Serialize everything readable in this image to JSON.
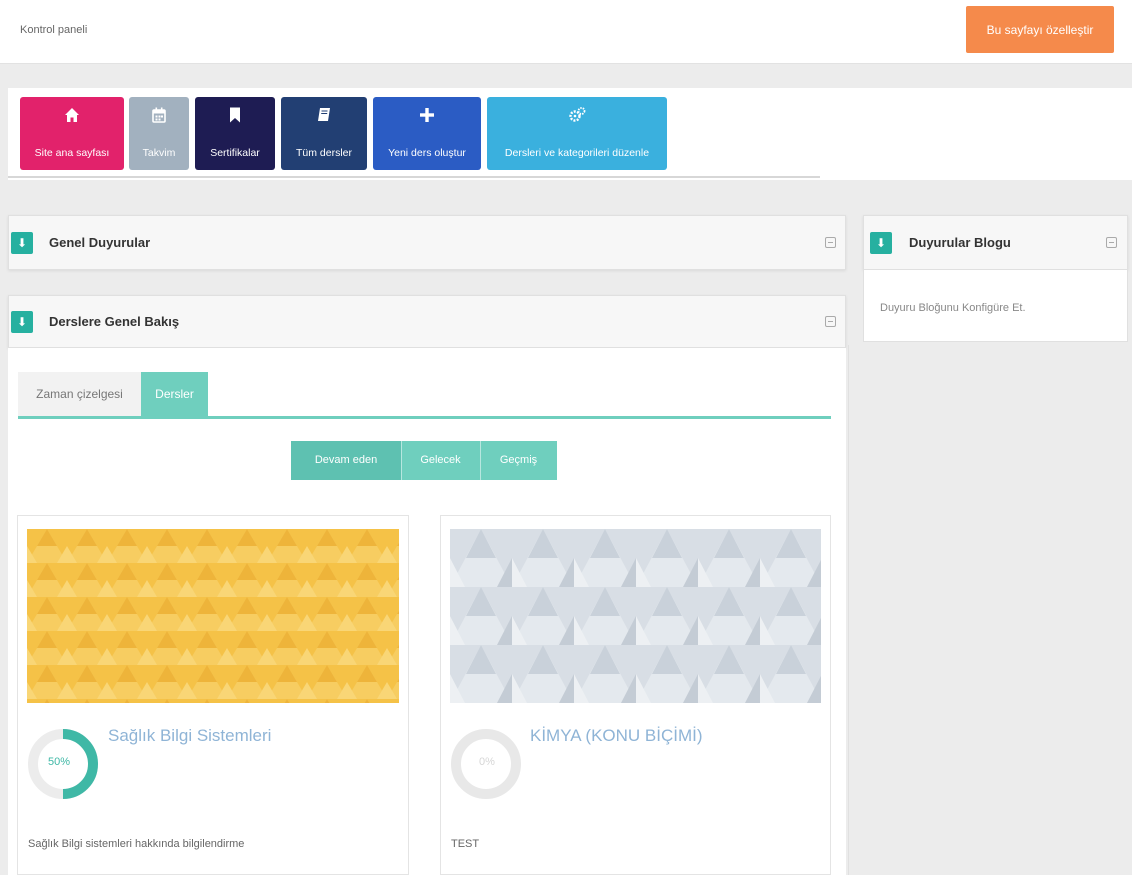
{
  "header": {
    "breadcrumb": "Kontrol paneli",
    "customize_button": "Bu sayfayı özelleştir"
  },
  "quick_links": [
    {
      "label": "Site ana sayfası",
      "icon": "home-icon",
      "color": "#e2226b"
    },
    {
      "label": "Takvim",
      "icon": "calendar-icon",
      "color": "#a2b1bf"
    },
    {
      "label": "Sertifikalar",
      "icon": "bookmark-icon",
      "color": "#1e1c53"
    },
    {
      "label": "Tüm dersler",
      "icon": "book-icon",
      "color": "#223f73"
    },
    {
      "label": "Yeni ders oluştur",
      "icon": "plus-icon",
      "color": "#2b5cc4"
    },
    {
      "label": "Dersleri ve kategorileri düzenle",
      "icon": "cogs-icon",
      "color": "#3ab0de"
    }
  ],
  "panels": {
    "announcements": "Genel Duyurular",
    "overview": "Derslere Genel Bakış",
    "blog": "Duyurular Blogu",
    "blog_link": "Duyuru Bloğunu Konfigüre Et."
  },
  "overview": {
    "tabs": [
      "Zaman çizelgesi",
      "Dersler"
    ],
    "active_tab": "Dersler",
    "filters": [
      "Devam eden",
      "Gelecek",
      "Geçmiş"
    ],
    "active_filter": "Devam eden"
  },
  "courses": [
    {
      "title": "Sağlık Bilgi Sistemleri",
      "progress_label": "50%",
      "progress": 0.5,
      "description": "Sağlık Bilgi sistemleri hakkında bilgilendirme",
      "pattern_color": "#f5c247"
    },
    {
      "title": "KİMYA (KONU BİÇİMİ)",
      "progress_label": "0%",
      "progress": 0,
      "description": "TEST",
      "pattern_color": "#cfd6de"
    }
  ],
  "colors": {
    "accent": "#26b0a0",
    "accent_light": "#6fcfbe",
    "orange": "#f58a4b",
    "link": "#8fb4d6"
  }
}
